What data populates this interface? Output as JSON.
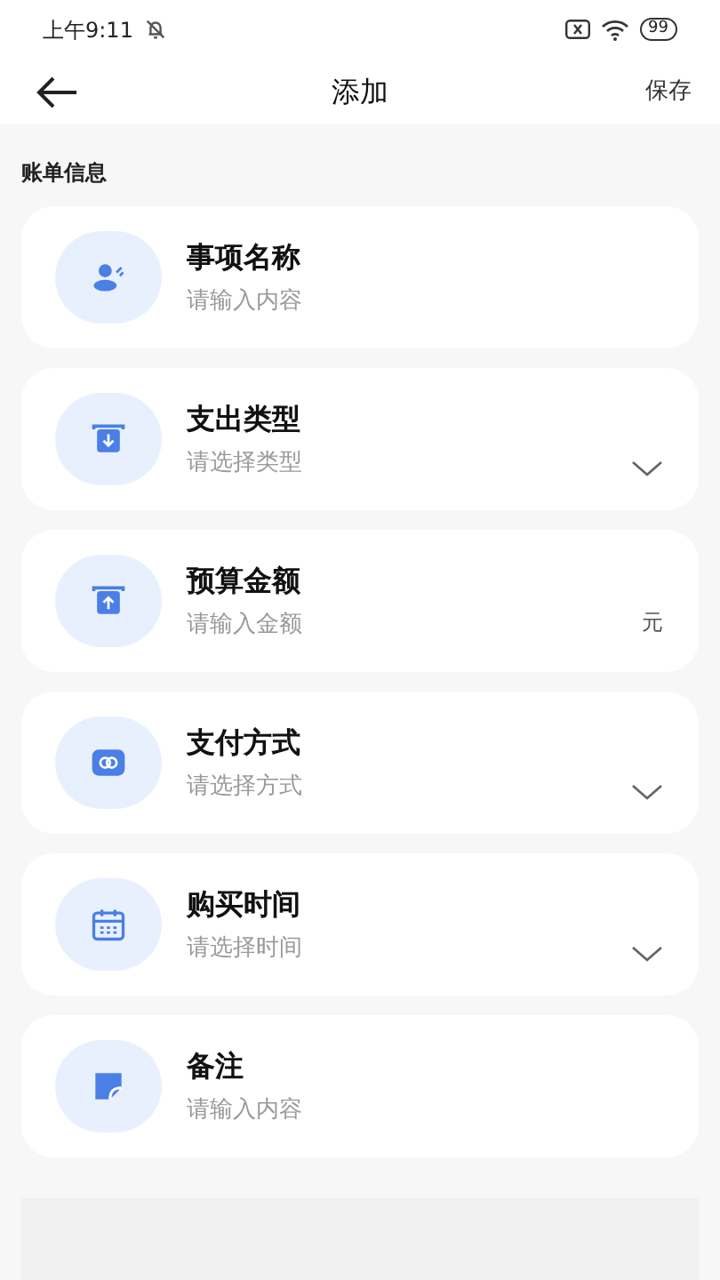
{
  "status_bar": {
    "time": "上午9:11",
    "battery": "99"
  },
  "nav": {
    "title": "添加",
    "action": "保存"
  },
  "section": {
    "title": "账单信息"
  },
  "fields": [
    {
      "kind": "text",
      "label": "事项名称",
      "placeholder": "请输入内容"
    },
    {
      "kind": "select",
      "label": "支出类型",
      "placeholder": "请选择类型"
    },
    {
      "kind": "amount",
      "label": "预算金额",
      "placeholder": "请输入金额",
      "suffix": "元"
    },
    {
      "kind": "select",
      "label": "支付方式",
      "placeholder": "请选择方式"
    },
    {
      "kind": "select",
      "label": "购买时间",
      "placeholder": "请选择时间"
    },
    {
      "kind": "text",
      "label": "备注",
      "placeholder": "请输入内容"
    }
  ]
}
